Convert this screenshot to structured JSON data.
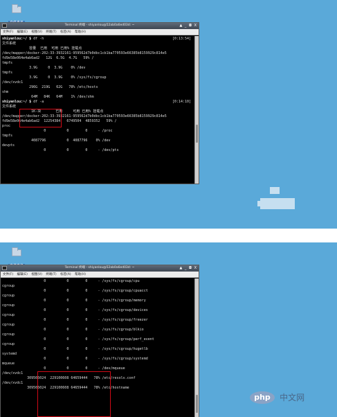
{
  "desktop": {
    "folder_label": "文件夹名"
  },
  "window": {
    "title": "Terminal 终端 - shiyanlou@52ab0a6ed03d: ~",
    "controls": "▲ _ ◘ X",
    "menu": [
      "文件(F)",
      "编辑(E)",
      "视图(V)",
      "终端(T)",
      "标签(A)",
      "帮助(H)"
    ]
  },
  "terminal_top": {
    "lines": [
      {
        "kind": "cmd",
        "prompt": "shiyanlou:~/ $",
        "command": " df -h",
        "time": "[0:13:54]"
      },
      {
        "text": "文件系统"
      },
      {
        "text": "             容量  已用  可用 已用% 挂载点"
      },
      {
        "text": "/dev/mapper/docker-202:33-3932161-959562d7b0dbc1cb1ba770593e66385b8159929c814e5"
      },
      {
        "text": "fd9e58e064e4ab6ad2   12G  6.5G  4.7G   59% /"
      },
      {
        "text": "tmpfs"
      },
      {
        "text": "             3.9G     0  3.9G    0% /dev"
      },
      {
        "text": "tmpfs"
      },
      {
        "text": "             3.9G     0  3.9G    0% /sys/fs/cgroup"
      },
      {
        "text": "/dev/xvdc1"
      },
      {
        "text": "             296G  219G   62G   78% /etc/hosts"
      },
      {
        "text": "shm"
      },
      {
        "text": "              64M   84K   64M    1% /dev/shm"
      },
      {
        "kind": "cmd",
        "prompt": "shiyanlou:~/ $",
        "command": " df -a",
        "time": "[0:14:10]"
      },
      {
        "text": "文件系统"
      },
      {
        "text": "              1K-块       已用     可用 已用% 挂载点"
      },
      {
        "text": "/dev/mapper/docker-202:33-3932161-959562d7b0dbc1cb1ba770593e66385b8159929c814e5"
      },
      {
        "text": "fd9e58e064e4ab6ad2  12254384   6749504  4859352   59% /"
      },
      {
        "text": "proc"
      },
      {
        "text": "                    0          0        0     - /proc"
      },
      {
        "text": "tmpfs"
      },
      {
        "text": "              4087796          0  4087796    0% /dev"
      },
      {
        "text": "devpts"
      },
      {
        "text": "                    0          0        0     - /dev/pts"
      }
    ]
  },
  "terminal_bottom": {
    "lines": [
      {
        "text": "                    0          0        0     - /sys/fs/cgroup/cpu"
      },
      {
        "text": "cgroup"
      },
      {
        "text": "                    0          0        0     - /sys/fs/cgroup/cpuacct"
      },
      {
        "text": "cgroup"
      },
      {
        "text": "                    0          0        0     - /sys/fs/cgroup/memory"
      },
      {
        "text": "cgroup"
      },
      {
        "text": "                    0          0        0     - /sys/fs/cgroup/devices"
      },
      {
        "text": "cgroup"
      },
      {
        "text": "                    0          0        0     - /sys/fs/cgroup/freezer"
      },
      {
        "text": "cgroup"
      },
      {
        "text": "                    0          0        0     - /sys/fs/cgroup/blkio"
      },
      {
        "text": "cgroup"
      },
      {
        "text": "                    0          0        0     - /sys/fs/cgroup/perf_event"
      },
      {
        "text": "cgroup"
      },
      {
        "text": "                    0          0        0     - /sys/fs/cgroup/hugetlb"
      },
      {
        "text": "systemd"
      },
      {
        "text": "                    0          0        0     - /sys/fs/cgroup/systemd"
      },
      {
        "text": "mqueue"
      },
      {
        "text": "                    0          0        0     - /dev/mqueue"
      },
      {
        "text": "/dev/xvdc1"
      },
      {
        "text": "            309505024  229100608 64659444   78% /etc/resolv.conf"
      },
      {
        "text": "/dev/xvdc1"
      },
      {
        "text": "            309505024  229100608 64659444   78% /etc/hostname"
      }
    ]
  },
  "watermark": {
    "badge": "php",
    "site": "中文网"
  },
  "colors": {
    "desktop_bg": "#5aa9d9",
    "terminal_bg": "#000000",
    "highlight_box": "#d10a16"
  }
}
